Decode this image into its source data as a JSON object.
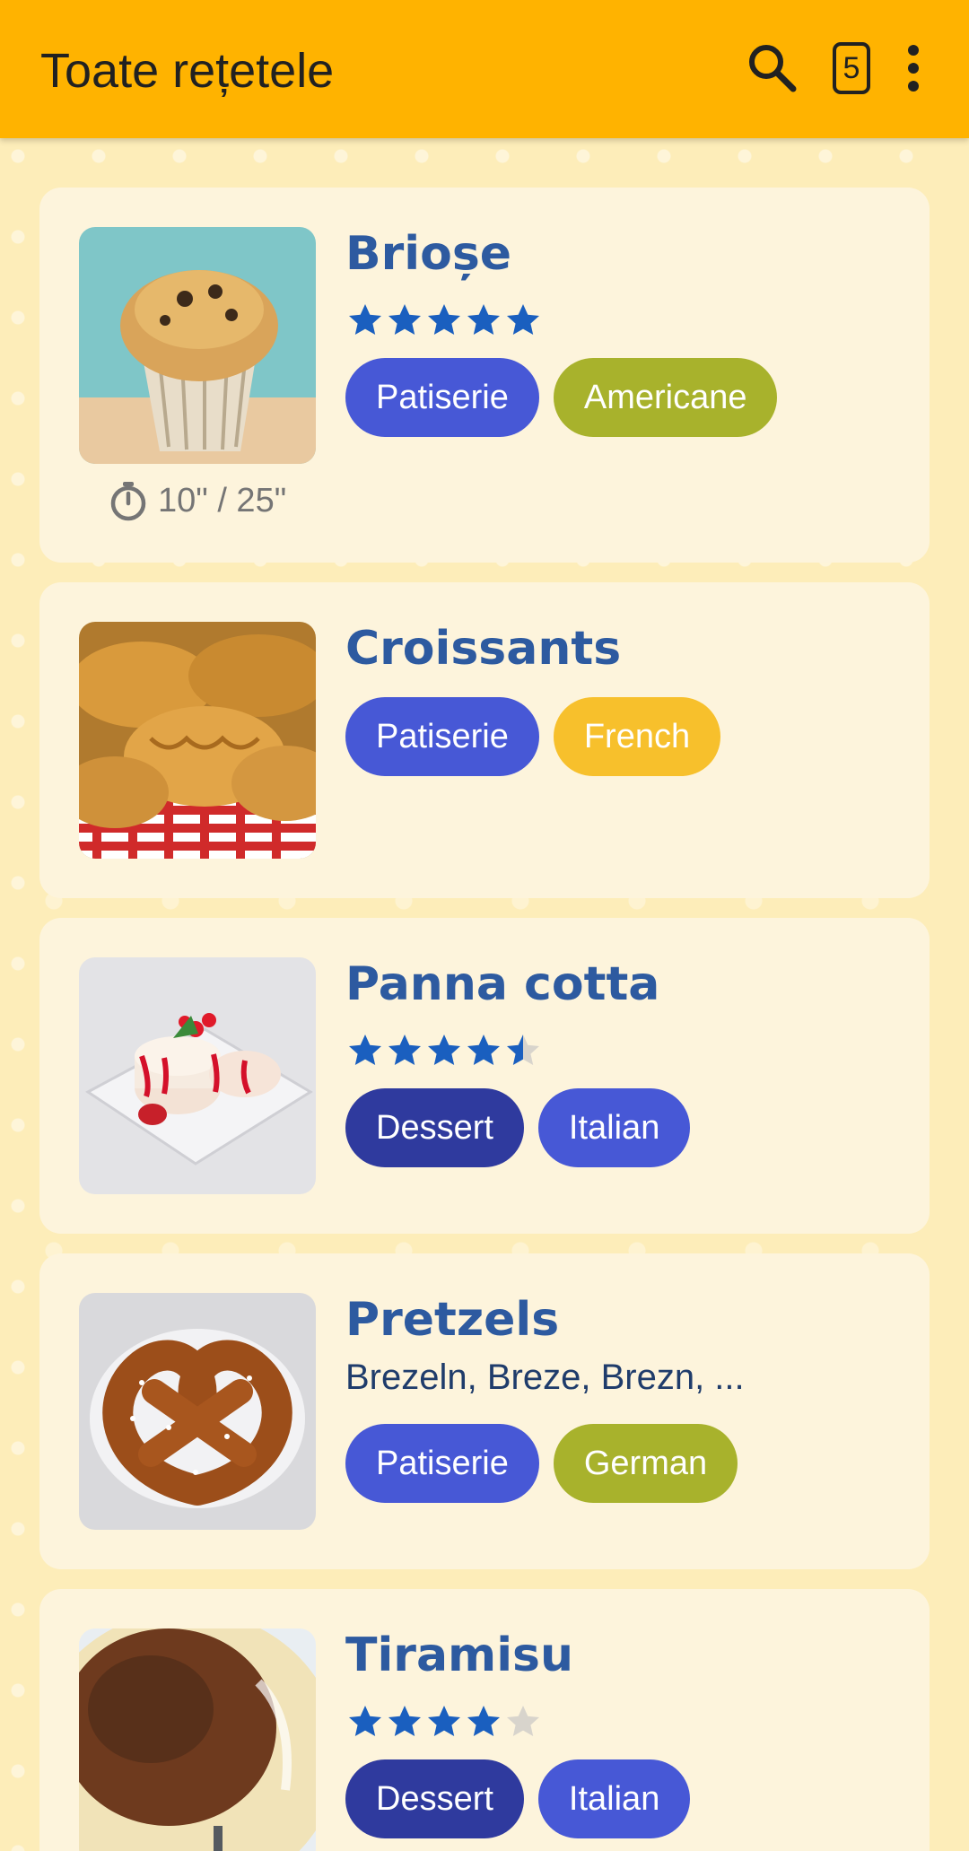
{
  "appbar": {
    "title": "Toate rețetele",
    "badge_count": "5",
    "color": "#ffb300"
  },
  "colors": {
    "patisserie": "#4758d6",
    "dessert": "#2f3a9e",
    "italian": "#4758d6",
    "americane": "#a8b22c",
    "german": "#a8b22c",
    "french": "#f7c02c",
    "title": "#2d5aa0",
    "star": "#1a5fbf",
    "star_empty": "#d8d4cc"
  },
  "recipes": [
    {
      "name": "Brioșe",
      "rating": 5,
      "tags": [
        "Patiserie",
        "Americane"
      ],
      "time": "10\" / 25\"",
      "image_icon": "muffin-photo"
    },
    {
      "name": "Croissants",
      "tags": [
        "Patiserie",
        "French"
      ],
      "image_icon": "croissants-photo"
    },
    {
      "name": "Panna cotta",
      "rating": 4.5,
      "tags": [
        "Dessert",
        "Italian"
      ],
      "image_icon": "panna-cotta-photo"
    },
    {
      "name": "Pretzels",
      "alt_names": "Brezeln, Breze, Brezn, ...",
      "tags": [
        "Patiserie",
        "German"
      ],
      "image_icon": "pretzel-photo"
    },
    {
      "name": "Tiramisu",
      "rating": 4,
      "tags": [
        "Dessert",
        "Italian"
      ],
      "image_icon": "tiramisu-photo"
    }
  ]
}
